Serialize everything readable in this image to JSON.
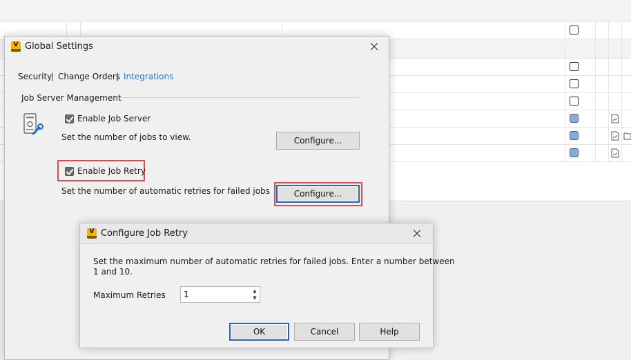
{
  "global_settings": {
    "title": "Global Settings",
    "tabs": [
      {
        "label": "Security"
      },
      {
        "label": "Change Orders"
      },
      {
        "label": "Integrations"
      }
    ],
    "tab_separator": "|",
    "group_title": "Job Server Management",
    "enable_job_server": {
      "label": "Enable Job Server",
      "checked": true
    },
    "jobs_to_view_text": "Set the number of jobs to view.",
    "configure_button_1": "Configure...",
    "enable_job_retry": {
      "label": "Enable Job Retry",
      "checked": true
    },
    "retries_text": "Set the number of automatic retries for failed jobs",
    "configure_button_2": "Configure..."
  },
  "configure_job_retry": {
    "title": "Configure Job Retry",
    "description_line1": "Set the maximum number of automatic retries for failed jobs. Enter a number between",
    "description_line2": "1 and 10.",
    "max_retries_label": "Maximum Retries",
    "max_retries_value": "1",
    "ok_button": "OK",
    "cancel_button": "Cancel",
    "help_button": "Help"
  },
  "app_icon_letter": "V",
  "colors": {
    "accent_tab": "#2a78b8",
    "highlight": "#e04a4a",
    "default_button_border": "#1f66b8",
    "app_icon": "#f4b400",
    "status_square": "#8aa8e0"
  }
}
